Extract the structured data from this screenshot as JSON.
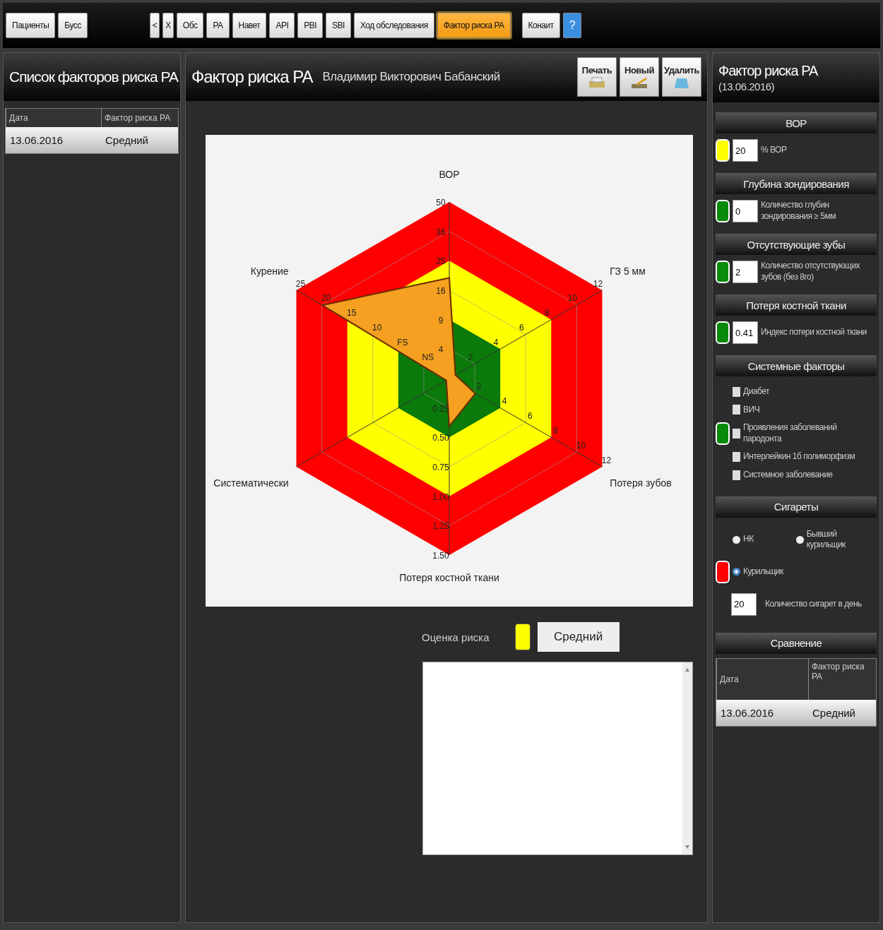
{
  "toolbar": {
    "left_buttons": [
      {
        "label": "Пациенты"
      },
      {
        "label": "Бусс"
      }
    ],
    "nav_buttons": [
      {
        "label": "<"
      },
      {
        "label": "X"
      }
    ],
    "tabs": [
      {
        "label": "Обс",
        "selected": false
      },
      {
        "label": "PA",
        "selected": false
      },
      {
        "label": "Навет",
        "selected": false
      },
      {
        "label": "API",
        "selected": false
      },
      {
        "label": "PBI",
        "selected": false
      },
      {
        "label": "SBI",
        "selected": false
      },
      {
        "label": "Ход обследования",
        "selected": false
      },
      {
        "label": "Фактор риска PA",
        "selected": true
      }
    ],
    "right_buttons": [
      {
        "label": "Конаит",
        "kind": "plain"
      },
      {
        "label": "?",
        "kind": "help"
      }
    ]
  },
  "list_panel": {
    "title": "Список факторов риска PA",
    "columns": [
      "Дата",
      "Фактор риска PA"
    ],
    "rows": [
      {
        "cells": [
          "13.06.2016",
          "Средний"
        ],
        "selected": true
      }
    ]
  },
  "main": {
    "title": "Фактор риска PA",
    "patient": "Владимир Викторович Бабанский",
    "actions": [
      {
        "label": "Печать",
        "kind": "print"
      },
      {
        "label": "Новый",
        "kind": "new"
      },
      {
        "label": "Удалить",
        "kind": "delete"
      }
    ],
    "radar_chart": {
      "axes": [
        {
          "name": "ВОР",
          "ticks": [
            "50",
            "36",
            "25",
            "16",
            "9",
            "4"
          ]
        },
        {
          "name": "ГЗ 5 мм",
          "ticks": [
            "2",
            "4",
            "6",
            "8",
            "10",
            "12"
          ]
        },
        {
          "name": "Потеря зубов",
          "ticks": [
            "2",
            "4",
            "6",
            "8",
            "10",
            "12"
          ]
        },
        {
          "name": "Потеря костной ткани",
          "ticks": [
            "0.25",
            "0.50",
            "0.75",
            "1.00",
            "1.25",
            "1.50"
          ]
        },
        {
          "name": "Систематически"
        },
        {
          "name": "Курение",
          "ticks": [
            "NS",
            "FS",
            "10",
            "15",
            "20",
            "25"
          ]
        }
      ]
    },
    "risk": {
      "label": "Оценка риска",
      "color": "#ffff00",
      "value": "Средний"
    }
  },
  "details": {
    "title": "Фактор риска PA",
    "date": "(13.06.2016)",
    "sections": [
      {
        "title": "ВОР",
        "kind": "input",
        "color": "#ffff00",
        "value": "20",
        "label": "% ВОР"
      },
      {
        "title": "Глубина зондирования",
        "kind": "input",
        "color": "#0a8a0a",
        "value": "0",
        "label": "Количество глубин зондирования ≥ 5мм"
      },
      {
        "title": "Отсутствующие зубы",
        "kind": "input",
        "color": "#0a8a0a",
        "value": "2",
        "label": "Количество отсутствующих зубов (без 8го)"
      },
      {
        "title": "Потеря костной ткани",
        "kind": "input",
        "color": "#0a8a0a",
        "value": "0.41",
        "label": "Индекс потери костной ткани"
      },
      {
        "title": "Системные факторы",
        "kind": "checks",
        "color": "#0a8a0a",
        "items": [
          {
            "label": "Диабет",
            "checked": false
          },
          {
            "label": "ВИЧ",
            "checked": false
          },
          {
            "label": "Проявления заболеваний пародонта",
            "checked": false
          },
          {
            "label": "Интерлейкин 1б полиморфизм",
            "checked": false
          },
          {
            "label": "Системное заболевание",
            "checked": false
          }
        ]
      },
      {
        "title": "Сигареты",
        "kind": "smoking",
        "color": "#ff0000",
        "options": [
          {
            "label": "НК",
            "selected": false
          },
          {
            "label": "Бывший курильщик",
            "selected": false
          },
          {
            "label": "Курильщик",
            "selected": true
          }
        ],
        "value": "20",
        "label": "Количество сигарет в день"
      },
      {
        "title": "Сравнение",
        "kind": "table",
        "columns": [
          "Дата",
          "Фактор риска PA"
        ],
        "rows": [
          {
            "cells": [
              "13.06.2016",
              "Средний"
            ],
            "selected": true
          }
        ]
      }
    ]
  }
}
